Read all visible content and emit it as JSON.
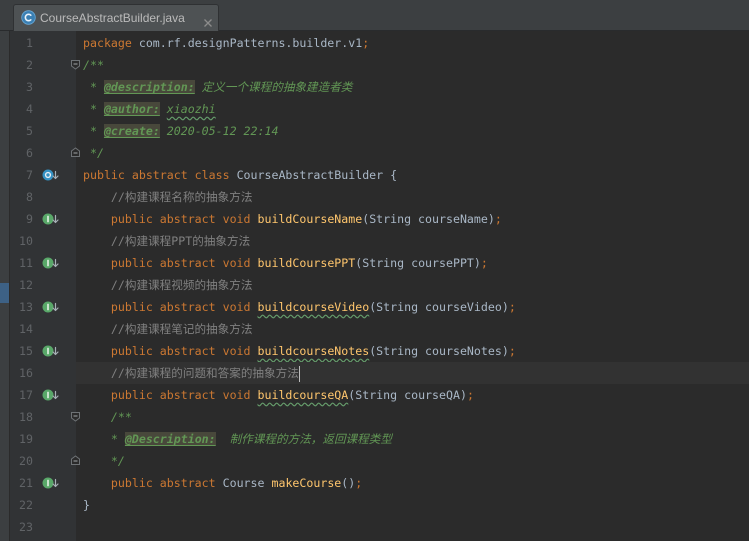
{
  "tab": {
    "title": "CourseAbstractBuilder.java",
    "icon": "class-icon",
    "close_icon": "close-icon"
  },
  "syntax_colors": {
    "background": "#2b2b2b",
    "gutter": "#313335",
    "line_number": "#606366",
    "caret_row": "#323232",
    "keyword": "#cc7832",
    "text": "#a9b7c6",
    "method": "#ffc66d",
    "line_comment": "#808080",
    "doc": "#629755",
    "semicolon": "#cc7832",
    "typo": "#659c6b",
    "warning_bg": "#48483b"
  },
  "editor": {
    "caret_line": 16,
    "lines": [
      {
        "number": 1,
        "tokens": [
          {
            "keyword": "package "
          },
          {
            "text": "com.rf.designPatterns.builder.v1"
          },
          {
            "semicolon": ";"
          }
        ]
      },
      {
        "number": 2,
        "fold": "fold-start-icon",
        "tokens": [
          {
            "doc": "/**"
          }
        ]
      },
      {
        "number": 3,
        "tokens": [
          {
            "doc": " * "
          },
          {
            "doc_tag": "@description:"
          },
          {
            "doc": " 定义一个课程的抽象建造者类"
          }
        ]
      },
      {
        "number": 4,
        "tokens": [
          {
            "doc": " * "
          },
          {
            "doc_tag": "@author:"
          },
          {
            "doc": " "
          },
          {
            "doc_typo": "xiaozhi"
          }
        ]
      },
      {
        "number": 5,
        "tokens": [
          {
            "doc": " * "
          },
          {
            "doc_tag": "@create:"
          },
          {
            "doc": " 2020-05-12 22:14"
          }
        ]
      },
      {
        "number": 6,
        "fold": "fold-end-icon",
        "tokens": [
          {
            "doc": " */"
          }
        ]
      },
      {
        "number": 7,
        "gutter_icon": "has-subclasses-icon",
        "tokens": [
          {
            "keyword": "public abstract class "
          },
          {
            "text": "CourseAbstractBuilder {"
          }
        ]
      },
      {
        "number": 8,
        "tokens": [
          {
            "line_comment": "    //构建课程名称的抽象方法"
          }
        ]
      },
      {
        "number": 9,
        "gutter_icon": "implemented-icon",
        "tokens": [
          {
            "keyword": "    public abstract void "
          },
          {
            "method": "buildCourseName"
          },
          {
            "text": "(String courseName)"
          },
          {
            "semicolon": ";"
          }
        ]
      },
      {
        "number": 10,
        "tokens": [
          {
            "line_comment": "    //构建课程PPT的抽象方法"
          }
        ]
      },
      {
        "number": 11,
        "gutter_icon": "implemented-icon",
        "tokens": [
          {
            "keyword": "    public abstract void "
          },
          {
            "method": "buildCoursePPT"
          },
          {
            "text": "(String coursePPT)"
          },
          {
            "semicolon": ";"
          }
        ]
      },
      {
        "number": 12,
        "tokens": [
          {
            "line_comment": "    //构建课程视频的抽象方法"
          }
        ]
      },
      {
        "number": 13,
        "gutter_icon": "implemented-icon",
        "tokens": [
          {
            "keyword": "    public abstract void "
          },
          {
            "method_typo": "buildcourseVideo"
          },
          {
            "text": "(String courseVideo)"
          },
          {
            "semicolon": ";"
          }
        ]
      },
      {
        "number": 14,
        "tokens": [
          {
            "line_comment": "    //构建课程笔记的抽象方法"
          }
        ]
      },
      {
        "number": 15,
        "gutter_icon": "implemented-icon",
        "tokens": [
          {
            "keyword": "    public abstract void "
          },
          {
            "method_typo": "buildcourseNotes"
          },
          {
            "text": "(String courseNotes)"
          },
          {
            "semicolon": ";"
          }
        ]
      },
      {
        "number": 16,
        "tokens": [
          {
            "line_comment": "    //构建课程的问题和答案的抽象方法"
          }
        ]
      },
      {
        "number": 17,
        "gutter_icon": "implemented-icon",
        "tokens": [
          {
            "keyword": "    public abstract void "
          },
          {
            "method_typo": "buildcourseQA"
          },
          {
            "text": "(String courseQA)"
          },
          {
            "semicolon": ";"
          }
        ]
      },
      {
        "number": 18,
        "fold": "fold-start-icon",
        "tokens": [
          {
            "doc": "    /**"
          }
        ]
      },
      {
        "number": 19,
        "tokens": [
          {
            "doc": "    * "
          },
          {
            "doc_tag": "@Description:"
          },
          {
            "doc": "  制作课程的方法，返回课程类型"
          }
        ]
      },
      {
        "number": 20,
        "fold": "fold-end-icon",
        "tokens": [
          {
            "doc": "    */"
          }
        ]
      },
      {
        "number": 21,
        "gutter_icon": "implemented-icon",
        "tokens": [
          {
            "keyword": "    public abstract "
          },
          {
            "text": "Course "
          },
          {
            "method": "makeCourse"
          },
          {
            "text": "()"
          },
          {
            "semicolon": ";"
          }
        ]
      },
      {
        "number": 22,
        "tokens": [
          {
            "text": "}"
          }
        ]
      },
      {
        "number": 23,
        "tokens": []
      }
    ]
  }
}
